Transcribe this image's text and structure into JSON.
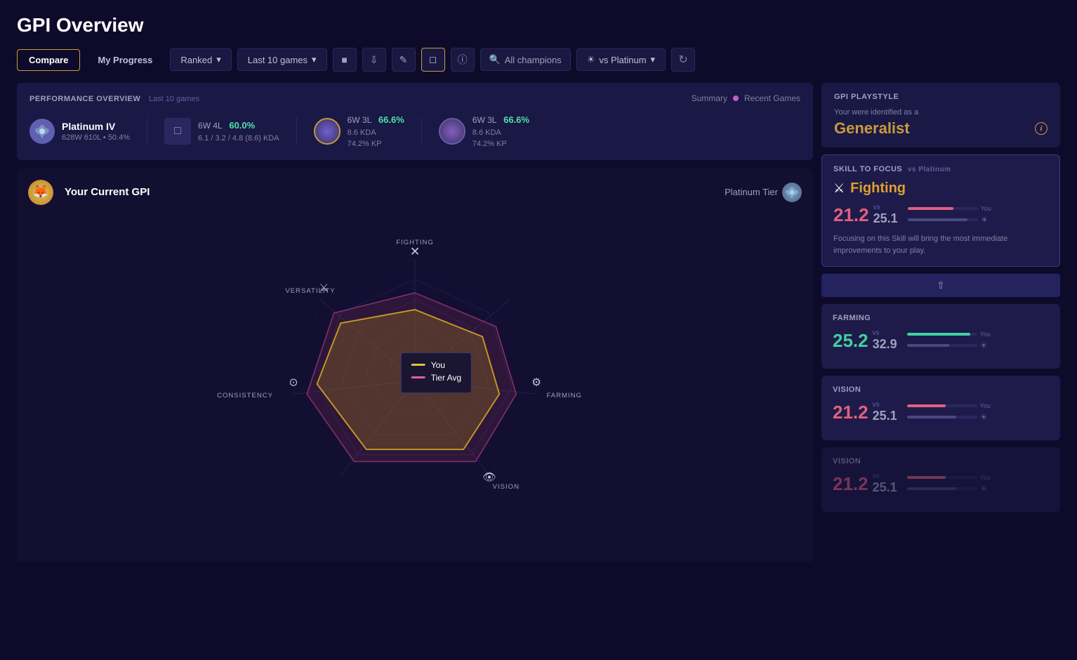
{
  "page": {
    "title": "GPI Overview"
  },
  "topnav": {
    "tab_compare": "Compare",
    "tab_myprogress": "My Progress",
    "dropdown_ranked": "Ranked",
    "dropdown_games": "Last 10 games",
    "search_placeholder": "All champions",
    "vs_label": "vs Platinum"
  },
  "performance": {
    "section_title": "PERFORMANCE OVERVIEW",
    "section_subtitle": "Last 10 games",
    "toggle_summary": "Summary",
    "toggle_recent": "Recent Games",
    "rank_name": "Platinum IV",
    "rank_record": "628W 610L • 50.4%",
    "stat1_wins": "6W",
    "stat1_losses": "4L",
    "stat1_winrate": "60.0%",
    "stat1_kda": "6.1 / 3.2 / 4.8 (8.6) KDA",
    "champ1_wins": "6W",
    "champ1_losses": "3L",
    "champ1_winrate": "66.6%",
    "champ1_kda": "8.6 KDA",
    "champ1_kp": "74.2% KP",
    "champ2_wins": "6W",
    "champ2_losses": "3L",
    "champ2_winrate": "66.6%",
    "champ2_kda": "8.6 KDA",
    "champ2_kp": "74.2% KP"
  },
  "gpi_playstyle": {
    "title": "GPI PLAYSTYLE",
    "identified_label": "Your were identified as a",
    "type": "Generalist"
  },
  "gpi_current": {
    "label": "Your Current GPI",
    "tier_label": "Platinum Tier"
  },
  "legend": {
    "you_label": "You",
    "tier_label": "Tier Avg"
  },
  "radar": {
    "labels": [
      "FIGHTING",
      "FARMING",
      "VISION",
      "CONSISTENCY",
      "VERSATILITY"
    ],
    "you_scores": [
      21.2,
      25.2,
      21.2,
      30,
      28
    ],
    "tier_scores": [
      25.1,
      32.9,
      25.1,
      35,
      33
    ]
  },
  "skill_focus": {
    "section_title": "SKILL TO FOCUS",
    "vs_label": "vs Platinum",
    "skill_icon": "⚔",
    "skill_name": "Fighting",
    "score_you": "21.2",
    "score_tier": "25.1",
    "description": "Focusing on this Skill will bring the most immediate improvements to your play."
  },
  "farming_card": {
    "title": "FARMING",
    "skill_icon": "🌾",
    "score_you": "25.2",
    "score_tier": "32.9"
  },
  "vision_card": {
    "title": "VISION",
    "skill_icon": "👁",
    "score_you": "21.2",
    "score_tier": "25.1"
  },
  "vision_card2": {
    "title": "VISION",
    "skill_icon": "👁",
    "score_you": "21.2",
    "score_tier": "25.1"
  }
}
